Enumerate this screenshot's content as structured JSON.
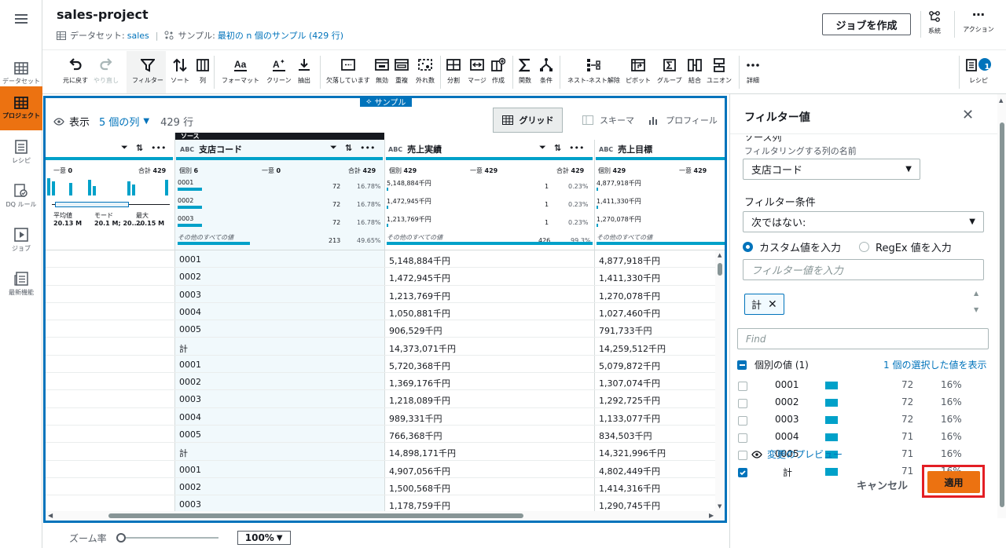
{
  "nav": {
    "datasets": "データセット",
    "projects": "プロジェクト",
    "recipes": "レシピ",
    "dq_rules": "DQ ルール",
    "jobs": "ジョブ",
    "whats_new": "最新機能"
  },
  "header": {
    "title": "sales-project",
    "dataset_label": "データセット:",
    "dataset_name": "sales",
    "sample_label": "サンプル:",
    "sample_value": "最初の n 個のサンプル (429 行)",
    "create_job": "ジョブを作成",
    "lineage": "系統",
    "actions": "アクション"
  },
  "toolbar": {
    "undo": "元に戻す",
    "redo": "やり直し",
    "filter": "フィルター",
    "sort": "ソート",
    "column": "列",
    "format": "フォーマット",
    "clean": "クリーン",
    "extract": "抽出",
    "missing": "欠落しています",
    "invalid": "無効",
    "duplicate": "重複",
    "outliers": "外れ数",
    "split": "分割",
    "merge": "マージ",
    "create": "作成",
    "functions": "関数",
    "conditions": "条件",
    "nest": "ネスト-ネスト解除",
    "pivot": "ピボット",
    "group": "グループ",
    "join": "結合",
    "union": "ユニオン",
    "more": "詳細",
    "recipe": "レシピ",
    "recipe_count": "1"
  },
  "grid": {
    "sample_tag": "サンプル",
    "view_label": "表示",
    "columns_count": "5 個の列",
    "rows_count": "429 行",
    "tab_grid": "グリッド",
    "tab_schema": "スキーマ",
    "tab_profile": "プロフィール",
    "source_tag": "ソース",
    "columns": [
      {
        "type": "ABC",
        "name": "支店コード"
      },
      {
        "type": "ABC",
        "name": "売上実績"
      },
      {
        "type": "ABC",
        "name": "売上目標"
      }
    ],
    "col0_stats": {
      "unique_label": "一意",
      "unique": "0",
      "total_label": "合計",
      "total": "429",
      "mean_label": "平均値",
      "mean": "20.13 M",
      "mode_label": "モード",
      "mode": "20.1 M; 20....",
      "max_label": "最大",
      "max": "20.15 M"
    },
    "col1_stats": {
      "distinct_label": "個別",
      "distinct": "6",
      "unique_label": "一意",
      "unique": "0",
      "total_label": "合計",
      "total": "429",
      "top": [
        {
          "v": "0001",
          "n": "72",
          "p": "16.78%"
        },
        {
          "v": "0002",
          "n": "72",
          "p": "16.78%"
        },
        {
          "v": "0003",
          "n": "72",
          "p": "16.78%"
        }
      ],
      "other_label": "その他のすべての値",
      "other_n": "213",
      "other_p": "49.65%"
    },
    "col2_stats": {
      "distinct_label": "個別",
      "distinct": "429",
      "unique_label": "一意",
      "unique": "429",
      "total_label": "合計",
      "total": "429",
      "top": [
        {
          "v": "5,148,884千円",
          "n": "1",
          "p": "0.23%"
        },
        {
          "v": "1,472,945千円",
          "n": "1",
          "p": "0.23%"
        },
        {
          "v": "1,213,769千円",
          "n": "1",
          "p": "0.23%"
        }
      ],
      "other_label": "その他のすべての値",
      "other_n": "426",
      "other_p": "99.3%"
    },
    "col3_stats": {
      "distinct_label": "個別",
      "distinct": "429",
      "unique_label": "一意",
      "unique": "429",
      "top": [
        {
          "v": "4,877,918千円"
        },
        {
          "v": "1,411,330千円"
        },
        {
          "v": "1,270,078千円"
        }
      ],
      "other_label": "その他のすべての値"
    },
    "rows": [
      [
        "0001",
        "5,148,884千円",
        "4,877,918千円"
      ],
      [
        "0002",
        "1,472,945千円",
        "1,411,330千円"
      ],
      [
        "0003",
        "1,213,769千円",
        "1,270,078千円"
      ],
      [
        "0004",
        "1,050,881千円",
        "1,027,460千円"
      ],
      [
        "0005",
        "906,529千円",
        "791,733千円"
      ],
      [
        "計",
        "14,373,071千円",
        "14,259,512千円"
      ],
      [
        "0001",
        "5,720,368千円",
        "5,079,872千円"
      ],
      [
        "0002",
        "1,369,176千円",
        "1,307,074千円"
      ],
      [
        "0003",
        "1,218,089千円",
        "1,292,725千円"
      ],
      [
        "0004",
        "989,331千円",
        "1,133,077千円"
      ],
      [
        "0005",
        "766,368千円",
        "834,503千円"
      ],
      [
        "計",
        "14,898,171千円",
        "14,321,996千円"
      ],
      [
        "0001",
        "4,907,056千円",
        "4,802,449千円"
      ],
      [
        "0002",
        "1,500,568千円",
        "1,414,316千円"
      ],
      [
        "0003",
        "1,178,759千円",
        "1,290,745千円"
      ]
    ]
  },
  "zoom": {
    "label": "ズーム率",
    "value": "100%"
  },
  "panel": {
    "title": "フィルター値",
    "source_col_label": "ソース列",
    "source_col_hint": "フィルタリングする列の名前",
    "source_col_value": "支店コード",
    "condition_label": "フィルター条件",
    "condition_value": "次ではない:",
    "radio_custom": "カスタム値を入力",
    "radio_regex": "RegEx 値を入力",
    "value_placeholder": "フィルター値を入力",
    "token": "計",
    "find_placeholder": "Find",
    "distinct_header": "個別の値 (1)",
    "show_selected": "1 個の選択した値を表示",
    "values": [
      {
        "v": "0001",
        "n": "72",
        "p": "16%",
        "checked": false
      },
      {
        "v": "0002",
        "n": "72",
        "p": "16%",
        "checked": false
      },
      {
        "v": "0003",
        "n": "72",
        "p": "16%",
        "checked": false
      },
      {
        "v": "0004",
        "n": "71",
        "p": "16%",
        "checked": false
      },
      {
        "v": "0005",
        "n": "71",
        "p": "16%",
        "checked": false
      },
      {
        "v": "計",
        "n": "71",
        "p": "16%",
        "checked": true
      }
    ],
    "preview_link": "変更のプレビュー",
    "cancel": "キャンセル",
    "apply": "適用"
  },
  "colors": {
    "accent": "#ec7211",
    "link": "#0073bb",
    "bar": "#00a1c9",
    "highlight": "#e31e24"
  }
}
